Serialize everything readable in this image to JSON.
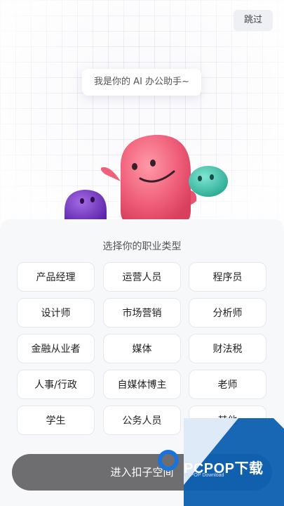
{
  "header": {
    "skip_label": "跳过"
  },
  "hero": {
    "bubble_text": "我是你的 AI 办公助手~"
  },
  "selection": {
    "title": "选择你的职业类型",
    "options": [
      "产品经理",
      "运营人员",
      "程序员",
      "设计师",
      "市场营销",
      "分析师",
      "金融从业者",
      "媒体",
      "财法税",
      "人事/行政",
      "自媒体博主",
      "老师",
      "学生",
      "公务人员",
      "其他"
    ]
  },
  "footer": {
    "enter_label": "进入扣子空间"
  },
  "watermark": {
    "brand": "PCPOP下载",
    "sub": "PCPOP Download"
  },
  "colors": {
    "mascot_pink": "#f2627a",
    "mascot_purple": "#7a3bc9",
    "mascot_teal": "#3fc7b0",
    "button_gray": "#6e6e70",
    "watermark_blue": "#0b5fb0"
  }
}
